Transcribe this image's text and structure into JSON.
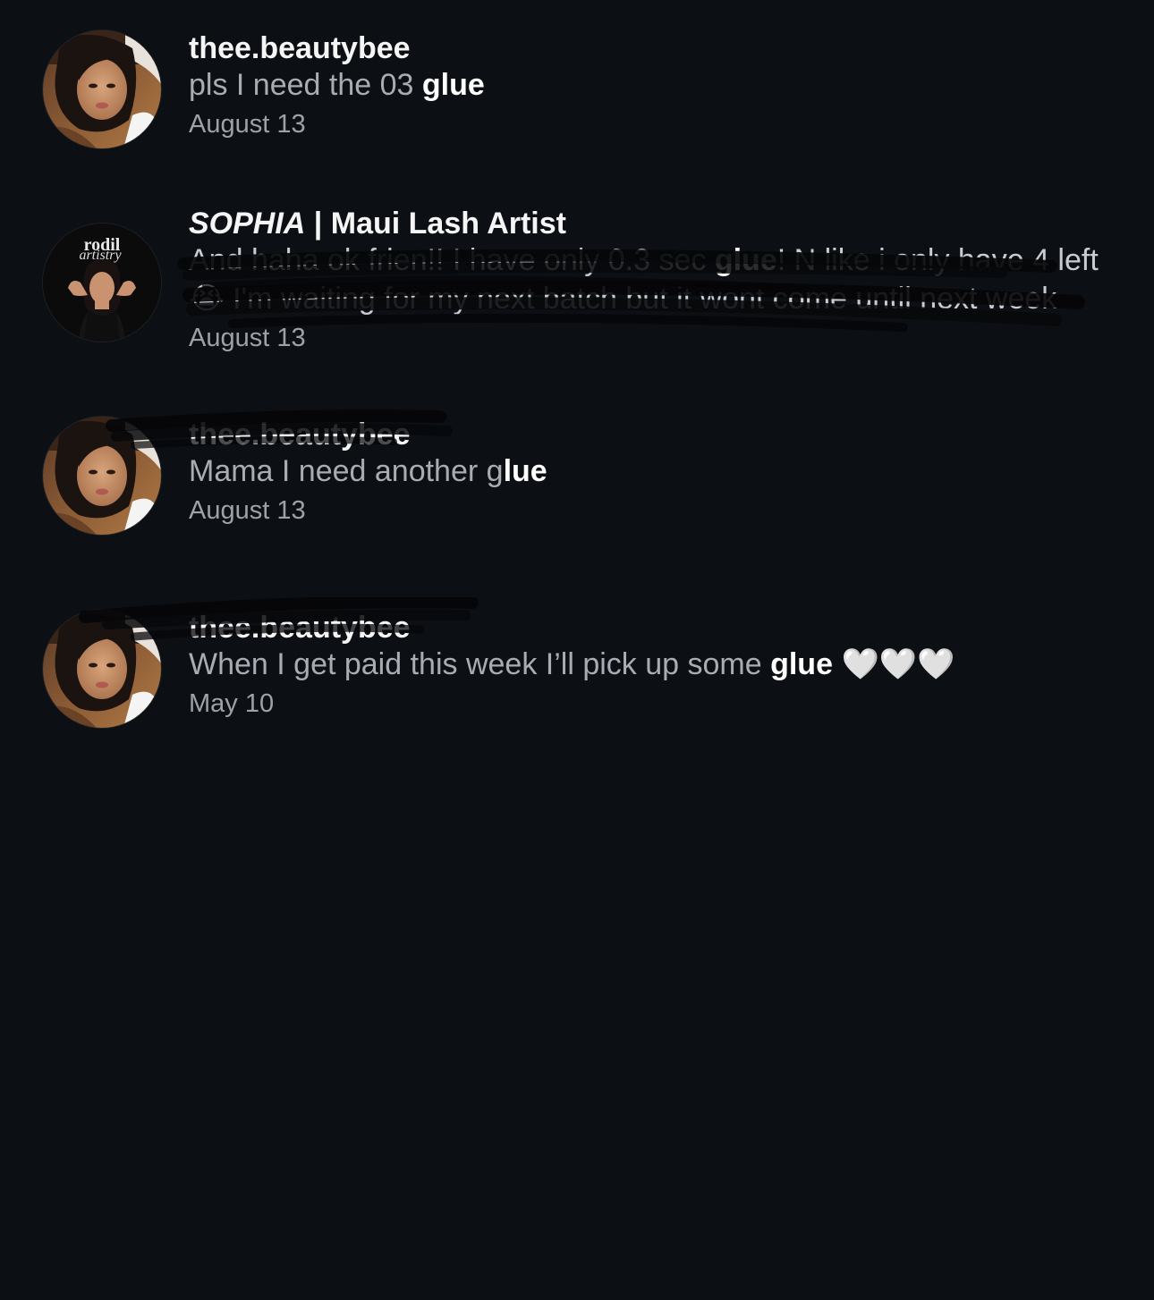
{
  "results": [
    {
      "username": "thee.beautybee",
      "snippet_before": "pls I need the 03 ",
      "keyword": "glue",
      "snippet_after": "",
      "date": "August 13",
      "avatar": "profile-photo-woman"
    },
    {
      "username_italic": "SOPHIA",
      "username_rest": " | Maui Lash Artist",
      "snippet_before": "And haha ok frien!! I have only 0.3 sec ",
      "keyword": "glue",
      "snippet_after": "! N like i only have 4 left 😭 I'm waiting for my next batch but it wont come until next week",
      "date": "August 13",
      "avatar": "rodil-artistry-logo",
      "avatar_logo_line1": "rodil",
      "avatar_logo_line2": "artistry"
    },
    {
      "username": "thee.beautybee",
      "snippet_before": "Mama I need another g",
      "keyword": "lue",
      "snippet_after": "",
      "date": "August 13",
      "avatar": "profile-photo-woman"
    },
    {
      "username": "thee.beautybee",
      "snippet_before": "When I get paid this week I’ll pick up some ",
      "keyword": "glue",
      "snippet_after": " 🤍🤍🤍",
      "date": "May 10",
      "avatar": "profile-photo-woman"
    }
  ],
  "colors": {
    "background": "#0c1014",
    "username": "#f5f5f5",
    "snippet": "#a8acb3",
    "keyword": "#ffffff",
    "date": "#9da1a8"
  }
}
